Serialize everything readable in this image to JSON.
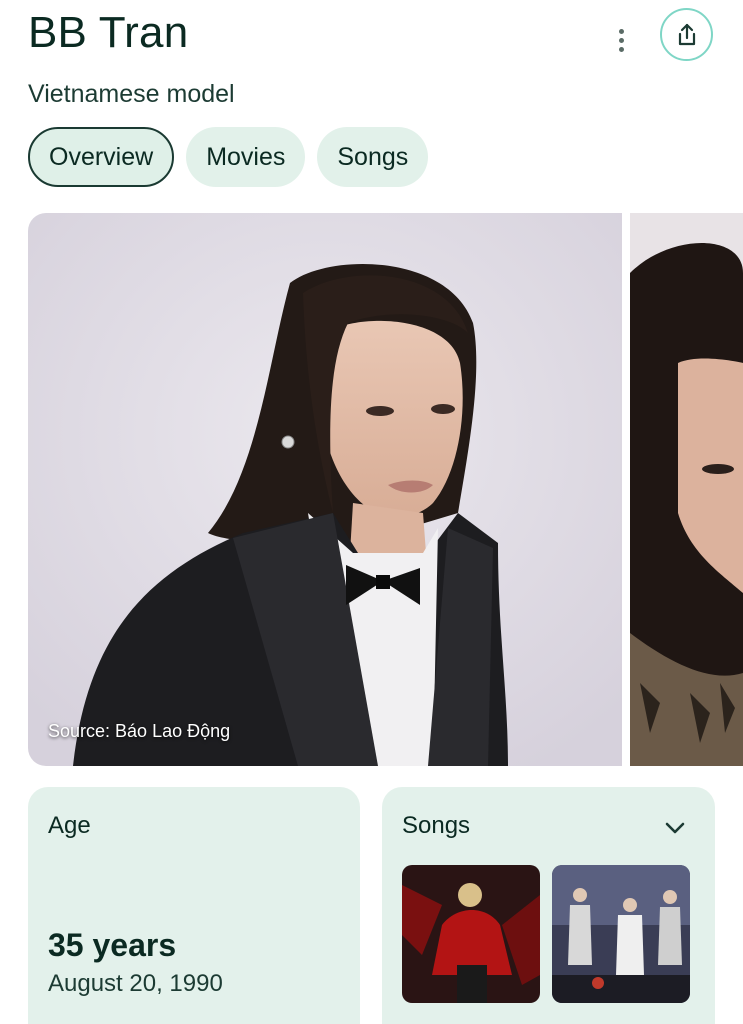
{
  "header": {
    "title": "BB Tran",
    "subtitle": "Vietnamese model"
  },
  "actions": {
    "more_icon": "more-vert-icon",
    "share_icon": "share-icon",
    "accent": "#7fd6c6"
  },
  "tabs": [
    {
      "label": "Overview",
      "active": true
    },
    {
      "label": "Movies",
      "active": false
    },
    {
      "label": "Songs",
      "active": false
    }
  ],
  "gallery": {
    "source": "Source: Báo Lao Động"
  },
  "cards": {
    "age": {
      "label": "Age",
      "value": "35 years",
      "date": "August 20, 1990"
    },
    "songs": {
      "label": "Songs",
      "expand_icon": "chevron-down-icon"
    }
  },
  "colors": {
    "chip_bg": "#e2f1ea",
    "card_bg": "#e3f1eb",
    "text": "#0b2a22"
  }
}
